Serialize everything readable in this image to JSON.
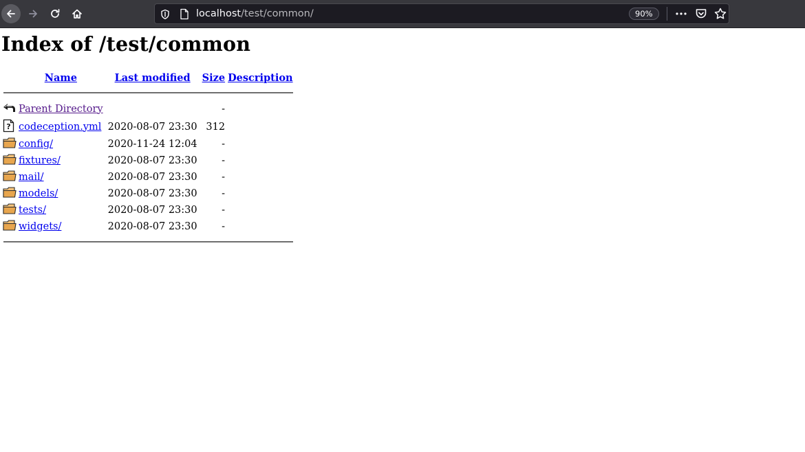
{
  "browser": {
    "url_host": "localhost",
    "url_path": "/test/common/",
    "zoom": "90%"
  },
  "page": {
    "title": "Index of /test/common"
  },
  "listing": {
    "headers": {
      "name": "Name",
      "last_modified": "Last modified",
      "size": "Size",
      "description": "Description"
    },
    "parent": {
      "label": "Parent Directory",
      "size": "-"
    },
    "rows": [
      {
        "name": "codeception.yml",
        "modified": "2020-08-07 23:30",
        "size": "312",
        "icon": "file-unknown-icon"
      },
      {
        "name": "config/",
        "modified": "2020-11-24 12:04",
        "size": "-",
        "icon": "folder-icon"
      },
      {
        "name": "fixtures/",
        "modified": "2020-08-07 23:30",
        "size": "-",
        "icon": "folder-icon"
      },
      {
        "name": "mail/",
        "modified": "2020-08-07 23:30",
        "size": "-",
        "icon": "folder-icon"
      },
      {
        "name": "models/",
        "modified": "2020-08-07 23:30",
        "size": "-",
        "icon": "folder-icon"
      },
      {
        "name": "tests/",
        "modified": "2020-08-07 23:30",
        "size": "-",
        "icon": "folder-icon"
      },
      {
        "name": "widgets/",
        "modified": "2020-08-07 23:30",
        "size": "-",
        "icon": "folder-icon"
      }
    ]
  }
}
